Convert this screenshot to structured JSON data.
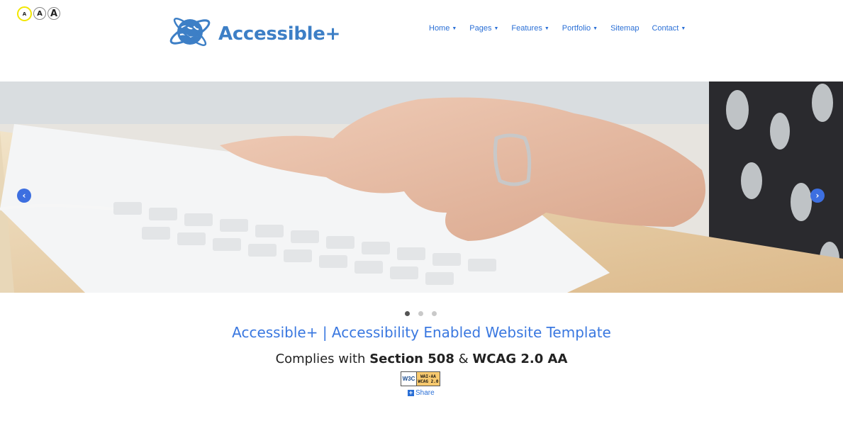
{
  "font_sizer": {
    "small": "A",
    "medium": "A",
    "large": "A"
  },
  "logo": {
    "text": "Accessible+"
  },
  "nav": [
    {
      "label": "Home",
      "dropdown": true
    },
    {
      "label": "Pages",
      "dropdown": true
    },
    {
      "label": "Features",
      "dropdown": true
    },
    {
      "label": "Portfolio",
      "dropdown": true
    },
    {
      "label": "Sitemap",
      "dropdown": false
    },
    {
      "label": "Contact",
      "dropdown": true
    }
  ],
  "carousel": {
    "prev_icon": "‹",
    "next_icon": "›",
    "slides": 3,
    "active_slide": 1
  },
  "tagline": "Accessible+ | Accessibility Enabled Website Template",
  "complies": {
    "prefix": "Complies with",
    "section": "Section 508",
    "amp": "&",
    "wcag": "WCAG 2.0 AA"
  },
  "badge": {
    "w3c": "W3C",
    "line1": "WAI-AA",
    "line2": "WCAG 2.0"
  },
  "share": {
    "label": "Share",
    "icon": "+"
  },
  "colors": {
    "brand": "#3d7fc6",
    "link": "#2a6fd6",
    "carousel_control": "#3d6fe0"
  }
}
